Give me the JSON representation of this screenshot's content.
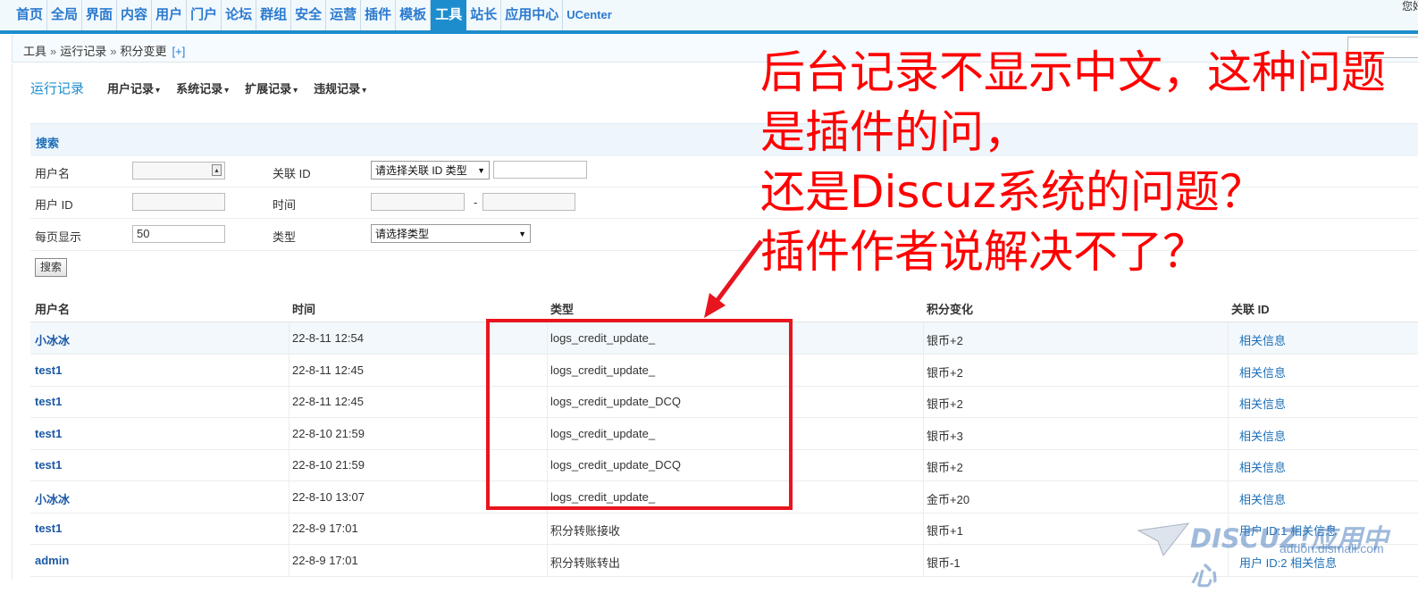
{
  "topnav": {
    "items": [
      "首页",
      "全局",
      "界面",
      "内容",
      "用户",
      "门户",
      "论坛",
      "群组",
      "安全",
      "运营",
      "插件",
      "模板",
      "工具",
      "站长",
      "应用中心",
      "UCenter"
    ],
    "active_index": 12,
    "greeting": "您好"
  },
  "breadcrumb": {
    "parts": [
      "工具",
      "运行记录",
      "积分变更"
    ],
    "separator": "»",
    "add_label": "[+]"
  },
  "subnav": {
    "title": "运行记录",
    "menus": [
      "用户记录",
      "系统记录",
      "扩展记录",
      "违规记录"
    ],
    "caret": "▾"
  },
  "search": {
    "header": "搜索",
    "username_label": "用户名",
    "userid_label": "用户 ID",
    "perpage_label": "每页显示",
    "perpage_value": "50",
    "relation_label": "关联 ID",
    "relation_select": "请选择关联 ID 类型",
    "time_label": "时间",
    "time_dash": "-",
    "type_label": "类型",
    "type_select": "请选择类型",
    "button": "搜索"
  },
  "table": {
    "headers": [
      "用户名",
      "时间",
      "类型",
      "积分变化",
      "关联 ID"
    ],
    "rows": [
      {
        "user": "小冰冰",
        "time": "22-8-11 12:54",
        "type": "logs_credit_update_",
        "change": "银币+2",
        "related": "相关信息"
      },
      {
        "user": "test1",
        "time": "22-8-11 12:45",
        "type": "logs_credit_update_",
        "change": "银币+2",
        "related": "相关信息"
      },
      {
        "user": "test1",
        "time": "22-8-11 12:45",
        "type": "logs_credit_update_DCQ",
        "change": "银币+2",
        "related": "相关信息"
      },
      {
        "user": "test1",
        "time": "22-8-10 21:59",
        "type": "logs_credit_update_",
        "change": "银币+3",
        "related": "相关信息"
      },
      {
        "user": "test1",
        "time": "22-8-10 21:59",
        "type": "logs_credit_update_DCQ",
        "change": "银币+2",
        "related": "相关信息"
      },
      {
        "user": "小冰冰",
        "time": "22-8-10 13:07",
        "type": "logs_credit_update_",
        "change": "金币+20",
        "related": "相关信息"
      },
      {
        "user": "test1",
        "time": "22-8-9 17:01",
        "type": "积分转账接收",
        "change": "银币+1",
        "related": "用户 ID:1 相关信息"
      },
      {
        "user": "admin",
        "time": "22-8-9 17:01",
        "type": "积分转账转出",
        "change": "银币-1",
        "related": "用户 ID:2 相关信息"
      }
    ]
  },
  "annotation": {
    "lines": [
      "后台记录不显示中文，这种问题",
      "是插件的问，",
      "还是Discuz系统的问题？",
      "插件作者说解决不了？"
    ],
    "color": "#ff0000"
  },
  "watermark": {
    "logo": "DISCUZ!应用中心",
    "url": "addon.dismall.com"
  },
  "colors": {
    "accent": "#1d8dcd",
    "link": "#1d6fb8",
    "annotation": "#ff0000"
  }
}
